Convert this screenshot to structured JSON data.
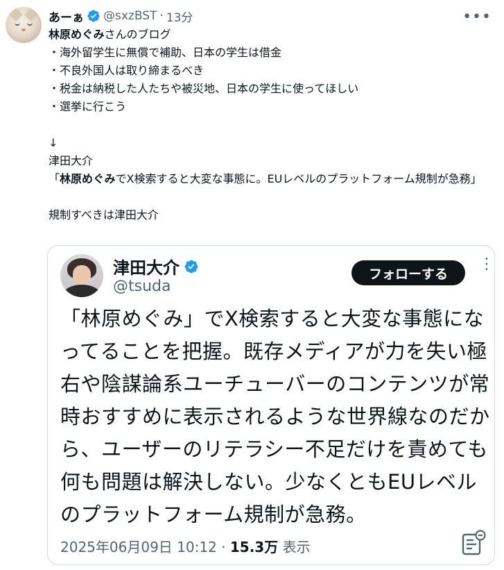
{
  "tweet": {
    "display_name": "あーぁ",
    "handle": "@sxzBST",
    "separator": "·",
    "time": "13分",
    "more_glyph": "•••",
    "lines": {
      "l1_bold": "林原めぐみ",
      "l1_rest": "さんのブログ",
      "l2": "・海外留学生に無償で補助、日本の学生は借金",
      "l3": "・不良外国人は取り締まるべき",
      "l4": "・税金は納税した人たちや被災地、日本の学生に使ってほしい",
      "l5": "・選挙に行こう",
      "l7": "↓",
      "l8": "津田大介",
      "l9_open": "「",
      "l9_bold": "林原めぐみ",
      "l9_rest": "でX検索すると大変な事態に。EUレベルのプラットフォーム規制が急務」",
      "l11": "規制すべきは津田大介"
    }
  },
  "quoted": {
    "display_name": "津田大介",
    "handle": "@tsuda",
    "follow_label": "フォローする",
    "more_glyph": "⋮",
    "text_lines": [
      "「林原めぐみ」でX検索すると大変な事態にな",
      "ってることを把握。既存メディアが力を失い極",
      "右や陰謀論系ユーチューバーのコンテンツが常",
      "時おすすめに表示されるような世界線なのだか",
      "ら、ユーザーのリテラシー不足だけを責めても",
      "何も問題は解決しない。少なくともEUレベル",
      "のプラットフォーム規制が急務。"
    ],
    "date": "2025年06月09日 10:12",
    "meta_sep": " · ",
    "views": "15.3万",
    "views_label": " 表示"
  },
  "colors": {
    "verified": "#1d9bf0",
    "text": "#0f1419",
    "muted": "#536471"
  }
}
